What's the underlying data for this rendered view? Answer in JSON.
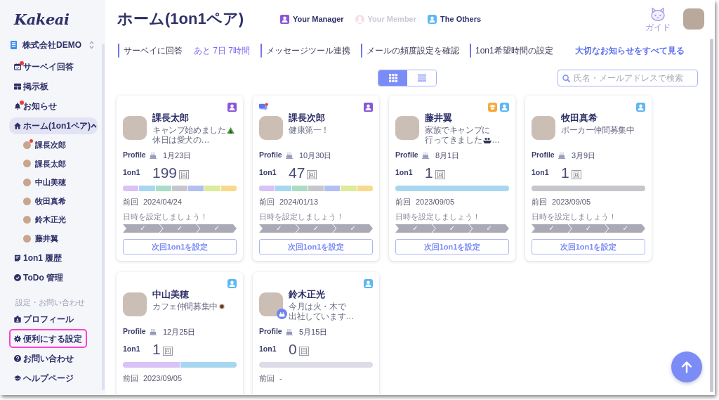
{
  "sidebar": {
    "logo": "Kakeai",
    "company": "株式会社DEMO",
    "items": [
      {
        "kind": "survey",
        "label": "サーベイ回答",
        "badge": true,
        "selected": false,
        "highlighted": false
      },
      {
        "kind": "board",
        "label": "掲示板",
        "badge": false,
        "selected": false,
        "highlighted": false
      },
      {
        "kind": "bell",
        "label": "お知らせ",
        "badge": true,
        "selected": false,
        "highlighted": false
      },
      {
        "kind": "home",
        "label": "ホーム(1on1ペア)",
        "badge": false,
        "selected": true,
        "highlighted": false,
        "expanded": true,
        "children": [
          {
            "label": "課長次郎",
            "badge": true
          },
          {
            "label": "課長太郎",
            "badge": false
          },
          {
            "label": "中山美穂",
            "badge": false
          },
          {
            "label": "牧田真希",
            "badge": false
          },
          {
            "label": "鈴木正光",
            "badge": false
          },
          {
            "label": "藤井翼",
            "badge": false
          }
        ]
      },
      {
        "kind": "history",
        "label": "1on1 履歴",
        "badge": false,
        "selected": false,
        "highlighted": false
      },
      {
        "kind": "todo",
        "label": "ToDo 管理",
        "badge": false,
        "selected": false,
        "highlighted": false
      },
      {
        "kind": "section",
        "label": "設定・お問い合わせ"
      },
      {
        "kind": "profile",
        "label": "プロフィール",
        "badge": false,
        "selected": false,
        "highlighted": false
      },
      {
        "kind": "gear",
        "label": "便利にする設定",
        "badge": false,
        "selected": false,
        "highlighted": true
      },
      {
        "kind": "help",
        "label": "お問い合わせ",
        "badge": false,
        "selected": false,
        "highlighted": false
      },
      {
        "kind": "graduation",
        "label": "ヘルプページ",
        "badge": false,
        "selected": false,
        "highlighted": false
      }
    ]
  },
  "header": {
    "title": "ホーム(1on1ペア)",
    "legend": [
      {
        "kind": "manager",
        "label": "Your Manager",
        "disabled": false
      },
      {
        "kind": "member",
        "label": "Your Member",
        "disabled": true
      },
      {
        "kind": "other",
        "label": "The Others",
        "disabled": false
      }
    ],
    "guide_label": "ガイド"
  },
  "notices": {
    "items": [
      {
        "label": "サーベイに回答",
        "deadline": "あと 7日 7時間"
      },
      {
        "label": "メッセージツール連携"
      },
      {
        "label": "メールの頻度設定を確認"
      },
      {
        "label": "1on1希望時間の設定"
      }
    ],
    "see_all": "大切なお知らせをすべて見る"
  },
  "view_toggle": [
    {
      "kind": "grid",
      "selected": true
    },
    {
      "kind": "list",
      "selected": false
    }
  ],
  "search": {
    "placeholder": "氏名・メールアドレスで検索"
  },
  "cards": [
    {
      "name": "課長太郎",
      "roles": [
        {
          "kind": "manager"
        }
      ],
      "unread_message": false,
      "birthday_badge": false,
      "status": [
        [
          {
            "kind": "text",
            "text": "キャンプ始めました"
          },
          {
            "kind": "tent"
          }
        ],
        [
          {
            "kind": "text",
            "text": "休日は愛犬の…"
          }
        ]
      ],
      "profile_label": "Profile",
      "profile_date": "1月23日",
      "count_label": "1on1",
      "count": "199",
      "count_unit": "回",
      "segments": [
        {
          "color": "#d8c2f6"
        },
        {
          "color": "#a7d7f0"
        },
        {
          "color": "#a9dcc4"
        },
        {
          "color": "#c6c7cd"
        },
        {
          "color": "#b2bff2"
        },
        {
          "color": "#dcec9b"
        },
        {
          "color": "#fad98d"
        }
      ],
      "prev_label": "前回",
      "prev_date": "2024/04/24",
      "hint": "日時を設定しましょう！",
      "steps": [
        "✓",
        "✓",
        "✓"
      ],
      "button": "次回1on1を設定"
    },
    {
      "name": "課長次郎",
      "roles": [
        {
          "kind": "manager"
        }
      ],
      "unread_message": true,
      "birthday_badge": false,
      "status": [
        [
          {
            "kind": "text",
            "text": "健康第一！"
          }
        ]
      ],
      "profile_label": "Profile",
      "profile_date": "10月30日",
      "count_label": "1on1",
      "count": "47",
      "count_unit": "回",
      "segments": [
        {
          "color": "#d8c2f6"
        },
        {
          "color": "#a7d7f0"
        },
        {
          "color": "#a9dcc4"
        },
        {
          "color": "#c6c7cd"
        },
        {
          "color": "#b2bff2"
        },
        {
          "color": "#dcec9b"
        },
        {
          "color": "#fad98d"
        }
      ],
      "prev_label": "前回",
      "prev_date": "2024/01/13",
      "hint": "日時を設定しましょう！",
      "steps": [
        "✓",
        "✓",
        "✓"
      ],
      "button": "次回1on1を設定"
    },
    {
      "name": "藤井翼",
      "roles": [
        {
          "kind": "mentor"
        },
        {
          "kind": "other"
        }
      ],
      "unread_message": false,
      "birthday_badge": false,
      "status": [
        [
          {
            "kind": "text",
            "text": "家族でキャンプに"
          }
        ],
        [
          {
            "kind": "text",
            "text": "行ってきました"
          },
          {
            "kind": "boat"
          },
          {
            "kind": "text",
            "text": "…"
          }
        ]
      ],
      "profile_label": "Profile",
      "profile_date": "8月1日",
      "count_label": "1on1",
      "count": "1",
      "count_unit": "回",
      "segments": [
        {
          "color": "#a7d7f0"
        }
      ],
      "prev_label": "前回",
      "prev_date": "2023/09/05",
      "hint": "日時を設定しましょう！",
      "steps": [
        "✓",
        "✓",
        "✓"
      ],
      "button": "次回1on1を設定"
    },
    {
      "name": "牧田真希",
      "roles": [
        {
          "kind": "other"
        }
      ],
      "unread_message": false,
      "birthday_badge": false,
      "status": [
        [
          {
            "kind": "text",
            "text": "ポーカー仲間募集中"
          }
        ]
      ],
      "profile_label": "Profile",
      "profile_date": "3月9日",
      "count_label": "1on1",
      "count": "1",
      "count_unit": "回",
      "segments": [
        {
          "color": "#c6c7cd"
        }
      ],
      "prev_label": "前回",
      "prev_date": "2023/09/05",
      "hint": "日時を設定しましょう！",
      "steps": [
        "✓",
        "✓",
        "✓"
      ],
      "button": "次回1on1を設定"
    },
    {
      "name": "中山美穂",
      "roles": [
        {
          "kind": "other"
        }
      ],
      "unread_message": false,
      "birthday_badge": false,
      "status": [
        [
          {
            "kind": "text",
            "text": "カフェ仲間募集中"
          },
          {
            "kind": "coffee"
          }
        ]
      ],
      "profile_label": "Profile",
      "profile_date": "12月25日",
      "count_label": "1on1",
      "count": "1",
      "count_unit": "回",
      "segments": [
        {
          "color": "#d8c2f6"
        },
        {
          "color": "#a7d7f0"
        }
      ],
      "prev_label": "前回",
      "prev_date": "2023/09/05"
    },
    {
      "name": "鈴木正光",
      "roles": [
        {
          "kind": "other"
        }
      ],
      "unread_message": false,
      "birthday_badge": true,
      "status": [
        [
          {
            "kind": "text",
            "text": "今月は火・木で"
          }
        ],
        [
          {
            "kind": "text",
            "text": "出社しています…"
          }
        ]
      ],
      "profile_label": "Profile",
      "profile_date": "5月15日",
      "count_label": "1on1",
      "count": "0",
      "count_unit": "回",
      "prev_label": "前回",
      "prev_date": "-"
    }
  ]
}
